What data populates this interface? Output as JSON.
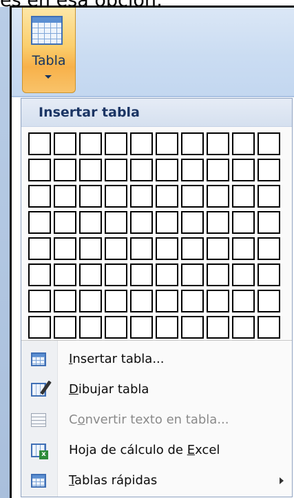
{
  "caption": "es en esa opción:",
  "ribbon": {
    "tabla_button": {
      "label": "Tabla",
      "icon": "table-icon"
    }
  },
  "dropdown": {
    "header": "Insertar tabla",
    "grid": {
      "columns": 10,
      "rows": 8
    },
    "menu_items": [
      {
        "label": "Insertar tabla...",
        "underline_index": 0,
        "icon": "insert-table-icon",
        "enabled": true,
        "submenu": false
      },
      {
        "label": "Dibujar tabla",
        "underline_index": 0,
        "icon": "draw-table-icon",
        "enabled": true,
        "submenu": false
      },
      {
        "label": "Convertir texto en tabla...",
        "underline_index": 1,
        "icon": "convert-text-icon",
        "enabled": false,
        "submenu": false
      },
      {
        "label": "Hoja de cálculo de Excel",
        "underline_index": 19,
        "icon": "excel-sheet-icon",
        "enabled": true,
        "submenu": false
      },
      {
        "label": "Tablas rápidas",
        "underline_index": 0,
        "icon": "quick-tables-icon",
        "enabled": true,
        "submenu": true
      }
    ]
  },
  "colors": {
    "button_highlight": "#f9c36a",
    "header_text": "#1b3564",
    "disabled_text": "#8a8a8a"
  }
}
